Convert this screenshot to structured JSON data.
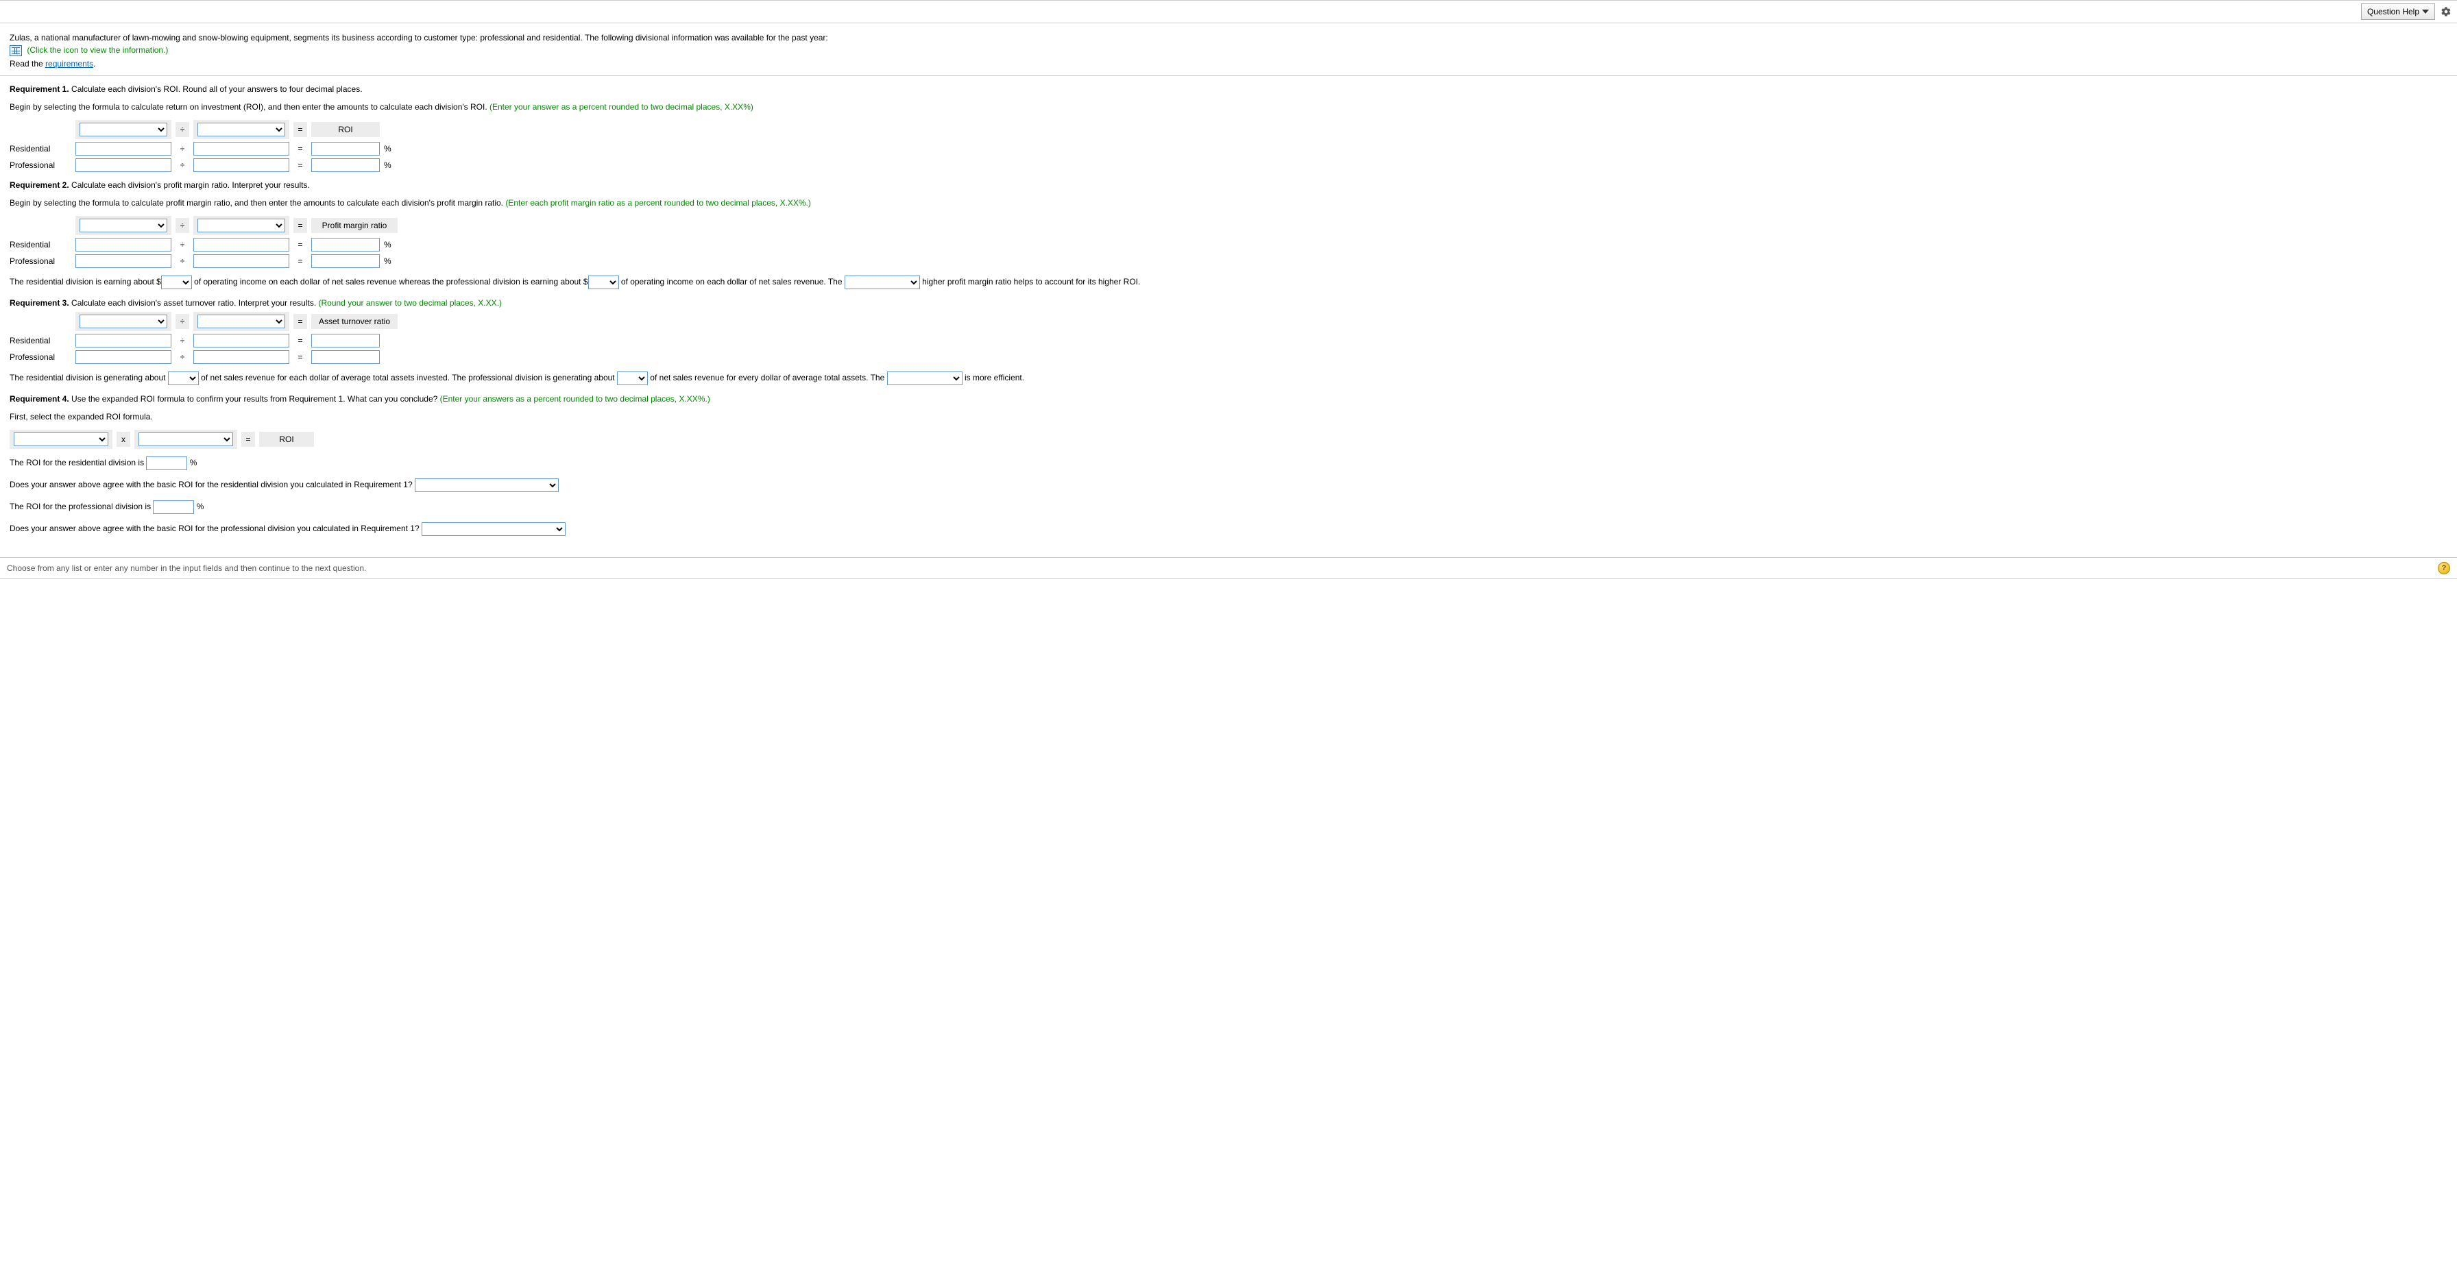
{
  "toolbar": {
    "question_help": "Question Help"
  },
  "intro": {
    "line1": "Zulas, a national manufacturer of lawn-mowing and snow-blowing equipment, segments its business according to customer type: professional and residential. The following divisional information was available for the past year:",
    "click_icon": "(Click the icon to view the information.)",
    "read_the": "Read the ",
    "requirements_link": "requirements",
    "period": "."
  },
  "labels": {
    "residential": "Residential",
    "professional": "Professional",
    "divide": "÷",
    "equals": "=",
    "times": "x",
    "percent": "%"
  },
  "req1": {
    "title_bold": "Requirement 1.",
    "title_rest": " Calculate each division's ROI. Round all of your answers to four decimal places.",
    "instr_plain": "Begin by selecting the formula to calculate return on investment (ROI), and then enter the amounts to calculate each division's ROI. ",
    "instr_hint": "(Enter your answer as a percent rounded to two decimal places, X.XX%)",
    "result_label": "ROI"
  },
  "req2": {
    "title_bold": "Requirement 2.",
    "title_rest": " Calculate each division's profit margin ratio. Interpret your results.",
    "instr_plain": "Begin by selecting the formula to calculate profit margin ratio, and then enter the amounts to calculate each division's profit margin ratio. ",
    "instr_hint": "(Enter each profit margin ratio as a percent rounded to two decimal places, X.XX%.)",
    "result_label": "Profit margin ratio",
    "s1": "The residential division is earning about $",
    "s2": " of operating income on each dollar of net sales revenue whereas the professional division is earning about $",
    "s3": " of operating income on each dollar of net sales revenue. The ",
    "s4": " higher profit margin ratio helps to account for its higher ROI."
  },
  "req3": {
    "title_bold": "Requirement 3. ",
    "title_rest": " Calculate each division's asset turnover ratio. Interpret your results. ",
    "title_hint": "(Round your answer to two decimal places, X.XX.)",
    "result_label": "Asset turnover ratio",
    "s1": "The residential division is generating about ",
    "s2": " of net sales revenue for each dollar of average total assets invested. The professional division is generating about ",
    "s3": " of net sales revenue for every dollar of average total assets. The ",
    "s4": " is more efficient."
  },
  "req4": {
    "title_bold": "Requirement 4.",
    "title_rest": " Use the expanded ROI formula to confirm your results from Requirement 1. What can you conclude? ",
    "title_hint": "(Enter your answers as a percent rounded to two decimal places, X.XX%.)",
    "first_select": "First, select the expanded ROI formula.",
    "roi_label": "ROI",
    "roi_res_label": "The ROI for the residential division is",
    "roi_pro_label": "The ROI for the professional division is",
    "agree_res": "Does your answer above agree with the basic ROI for the residential division you calculated in Requirement 1?",
    "agree_pro": "Does your answer above agree with the basic ROI for the professional division you calculated in Requirement 1?"
  },
  "footer": {
    "text": "Choose from any list or enter any number in the input fields and then continue to the next question."
  }
}
